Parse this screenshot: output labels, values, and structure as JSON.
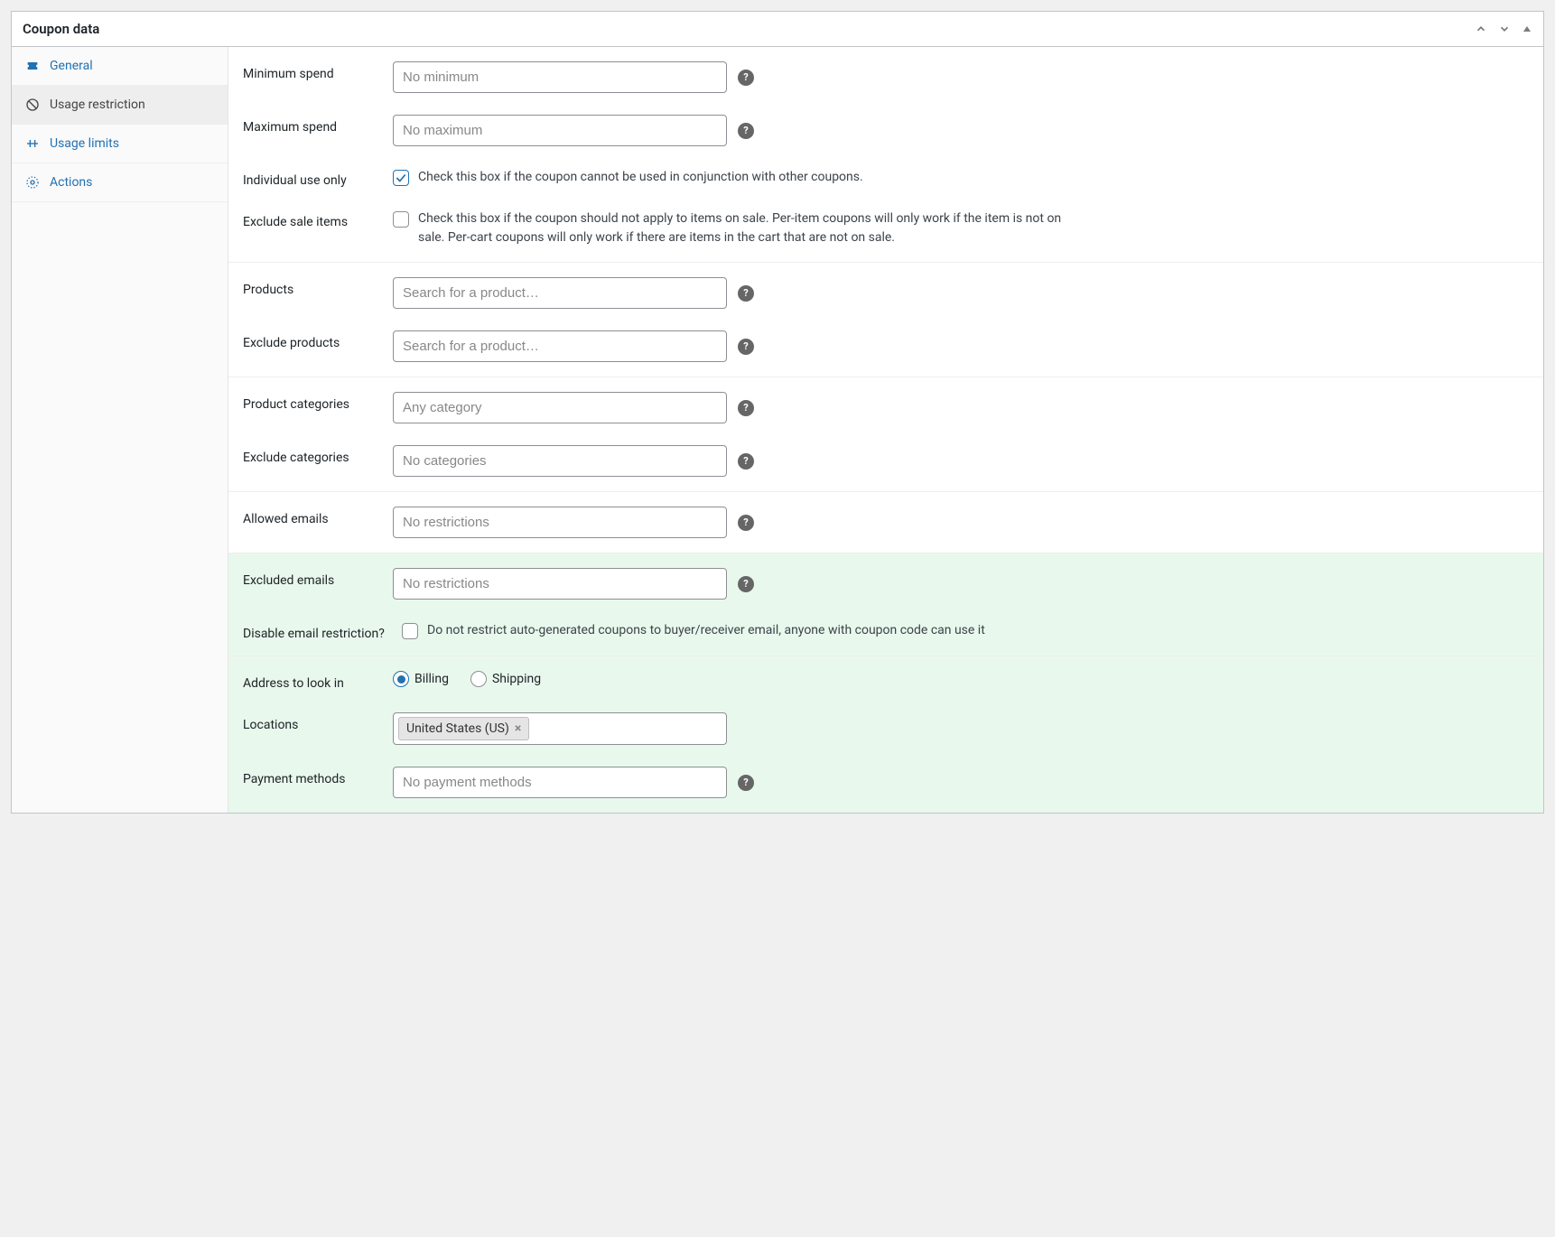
{
  "panel": {
    "title": "Coupon data"
  },
  "tabs": {
    "general": "General",
    "usage_restriction": "Usage restriction",
    "usage_limits": "Usage limits",
    "actions": "Actions"
  },
  "fields": {
    "minimum_spend": {
      "label": "Minimum spend",
      "placeholder": "No minimum"
    },
    "maximum_spend": {
      "label": "Maximum spend",
      "placeholder": "No maximum"
    },
    "individual_use": {
      "label": "Individual use only",
      "checked": true,
      "text": "Check this box if the coupon cannot be used in conjunction with other coupons."
    },
    "exclude_sale": {
      "label": "Exclude sale items",
      "checked": false,
      "text": "Check this box if the coupon should not apply to items on sale. Per-item coupons will only work if the item is not on sale. Per-cart coupons will only work if there are items in the cart that are not on sale."
    },
    "products": {
      "label": "Products",
      "placeholder": "Search for a product…"
    },
    "exclude_products": {
      "label": "Exclude products",
      "placeholder": "Search for a product…"
    },
    "product_categories": {
      "label": "Product categories",
      "placeholder": "Any category"
    },
    "exclude_categories": {
      "label": "Exclude categories",
      "placeholder": "No categories"
    },
    "allowed_emails": {
      "label": "Allowed emails",
      "placeholder": "No restrictions"
    },
    "excluded_emails": {
      "label": "Excluded emails",
      "placeholder": "No restrictions"
    },
    "disable_email": {
      "label": "Disable email restriction?",
      "checked": false,
      "text": "Do not restrict auto-generated coupons to buyer/receiver email, anyone with coupon code can use it"
    },
    "address_to_look_in": {
      "label": "Address to look in",
      "options": {
        "billing": "Billing",
        "shipping": "Shipping"
      },
      "selected": "billing"
    },
    "locations": {
      "label": "Locations",
      "value": "United States (US)"
    },
    "payment_methods": {
      "label": "Payment methods",
      "placeholder": "No payment methods"
    }
  }
}
